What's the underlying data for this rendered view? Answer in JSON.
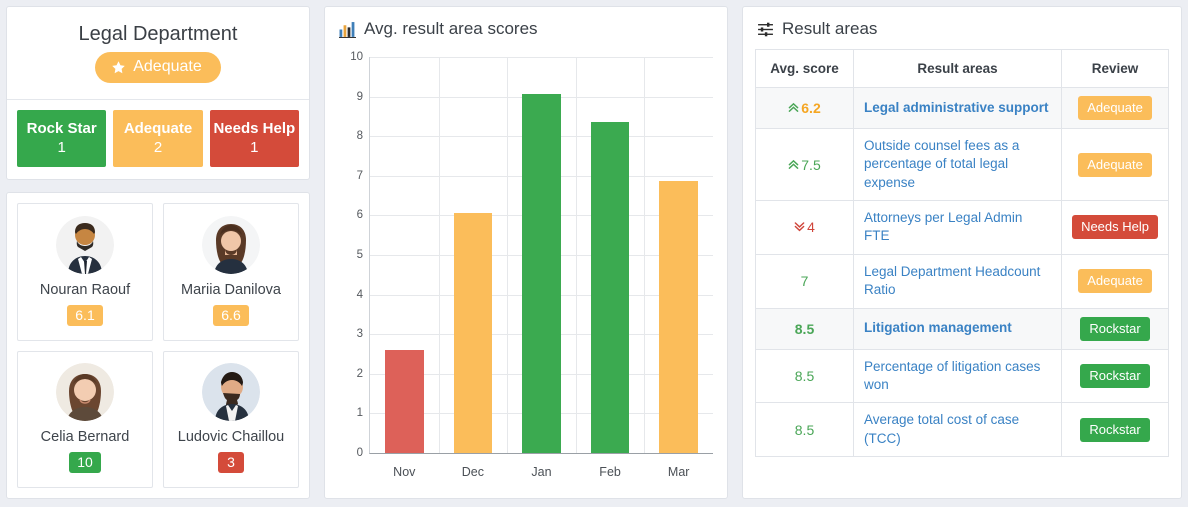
{
  "department": {
    "title": "Legal Department",
    "overall_badge": {
      "label": "Adequate",
      "icon": "star-icon",
      "color": "#fbbd5a"
    },
    "summary": [
      {
        "label": "Rock Star",
        "count": "1",
        "color": "#35a84c"
      },
      {
        "label": "Adequate",
        "count": "2",
        "color": "#fbbd5a"
      },
      {
        "label": "Needs Help",
        "count": "1",
        "color": "#d44b3a"
      }
    ]
  },
  "people": [
    {
      "name": "Nouran Raouf",
      "score": "6.1",
      "color": "#fbbd5a",
      "avatar": "man-suit-avatar"
    },
    {
      "name": "Mariia Danilova",
      "score": "6.6",
      "color": "#fbbd5a",
      "avatar": "woman-brown-hair-avatar"
    },
    {
      "name": "Celia Bernard",
      "score": "10",
      "color": "#35a84c",
      "avatar": "woman-smiling-avatar"
    },
    {
      "name": "Ludovic Chaillou",
      "score": "3",
      "color": "#d44b3a",
      "avatar": "man-beard-avatar"
    }
  ],
  "chart_panel": {
    "title": "Avg. result area scores",
    "icon": "bar-chart-icon"
  },
  "chart_data": {
    "type": "bar",
    "title": "Avg. result area scores",
    "xlabel": "",
    "ylabel": "",
    "ylim": [
      0,
      10
    ],
    "yticks": [
      "0",
      "1",
      "2",
      "3",
      "4",
      "5",
      "6",
      "7",
      "8",
      "9",
      "10"
    ],
    "grid": true,
    "legend": "none",
    "categories": [
      "Nov",
      "Dec",
      "Jan",
      "Feb",
      "Mar"
    ],
    "values": [
      2.6,
      6.05,
      9.07,
      8.35,
      6.87
    ],
    "colors": [
      "#dd6159",
      "#fbbd5a",
      "#3baa50",
      "#3baa50",
      "#fbbd5a"
    ]
  },
  "result_areas_panel": {
    "title": "Result areas",
    "icon": "sliders-icon",
    "columns": [
      "Avg. score",
      "Result areas",
      "Review"
    ],
    "rows": [
      {
        "score": "6.2",
        "score_color": "#f5a623",
        "trend": "up",
        "trend_icon": "chevron-double-up-icon",
        "name": "Legal administrative support",
        "highlight": true,
        "review": "Adequate",
        "review_color": "#fbbd5a"
      },
      {
        "score": "7.5",
        "score_color": "#4aa657",
        "trend": "up",
        "trend_icon": "chevron-double-up-icon",
        "name": "Outside counsel fees as a percentage of total legal expense",
        "highlight": false,
        "review": "Adequate",
        "review_color": "#fbbd5a"
      },
      {
        "score": "4",
        "score_color": "#d0453a",
        "trend": "down",
        "trend_icon": "chevron-double-down-icon",
        "name": "Attorneys per Legal Admin FTE",
        "highlight": false,
        "review": "Needs Help",
        "review_color": "#d44b3a"
      },
      {
        "score": "7",
        "score_color": "#4aa657",
        "trend": "none",
        "trend_icon": "",
        "name": "Legal Department Headcount Ratio",
        "highlight": false,
        "review": "Adequate",
        "review_color": "#fbbd5a"
      },
      {
        "score": "8.5",
        "score_color": "#4aa657",
        "trend": "none",
        "trend_icon": "",
        "name": "Litigation management",
        "highlight": true,
        "review": "Rockstar",
        "review_color": "#35a84c"
      },
      {
        "score": "8.5",
        "score_color": "#4aa657",
        "trend": "none",
        "trend_icon": "",
        "name": "Percentage of litigation cases won",
        "highlight": false,
        "review": "Rockstar",
        "review_color": "#35a84c"
      },
      {
        "score": "8.5",
        "score_color": "#4aa657",
        "trend": "none",
        "trend_icon": "",
        "name": "Average total cost of case (TCC)",
        "highlight": false,
        "review": "Rockstar",
        "review_color": "#35a84c"
      }
    ]
  }
}
